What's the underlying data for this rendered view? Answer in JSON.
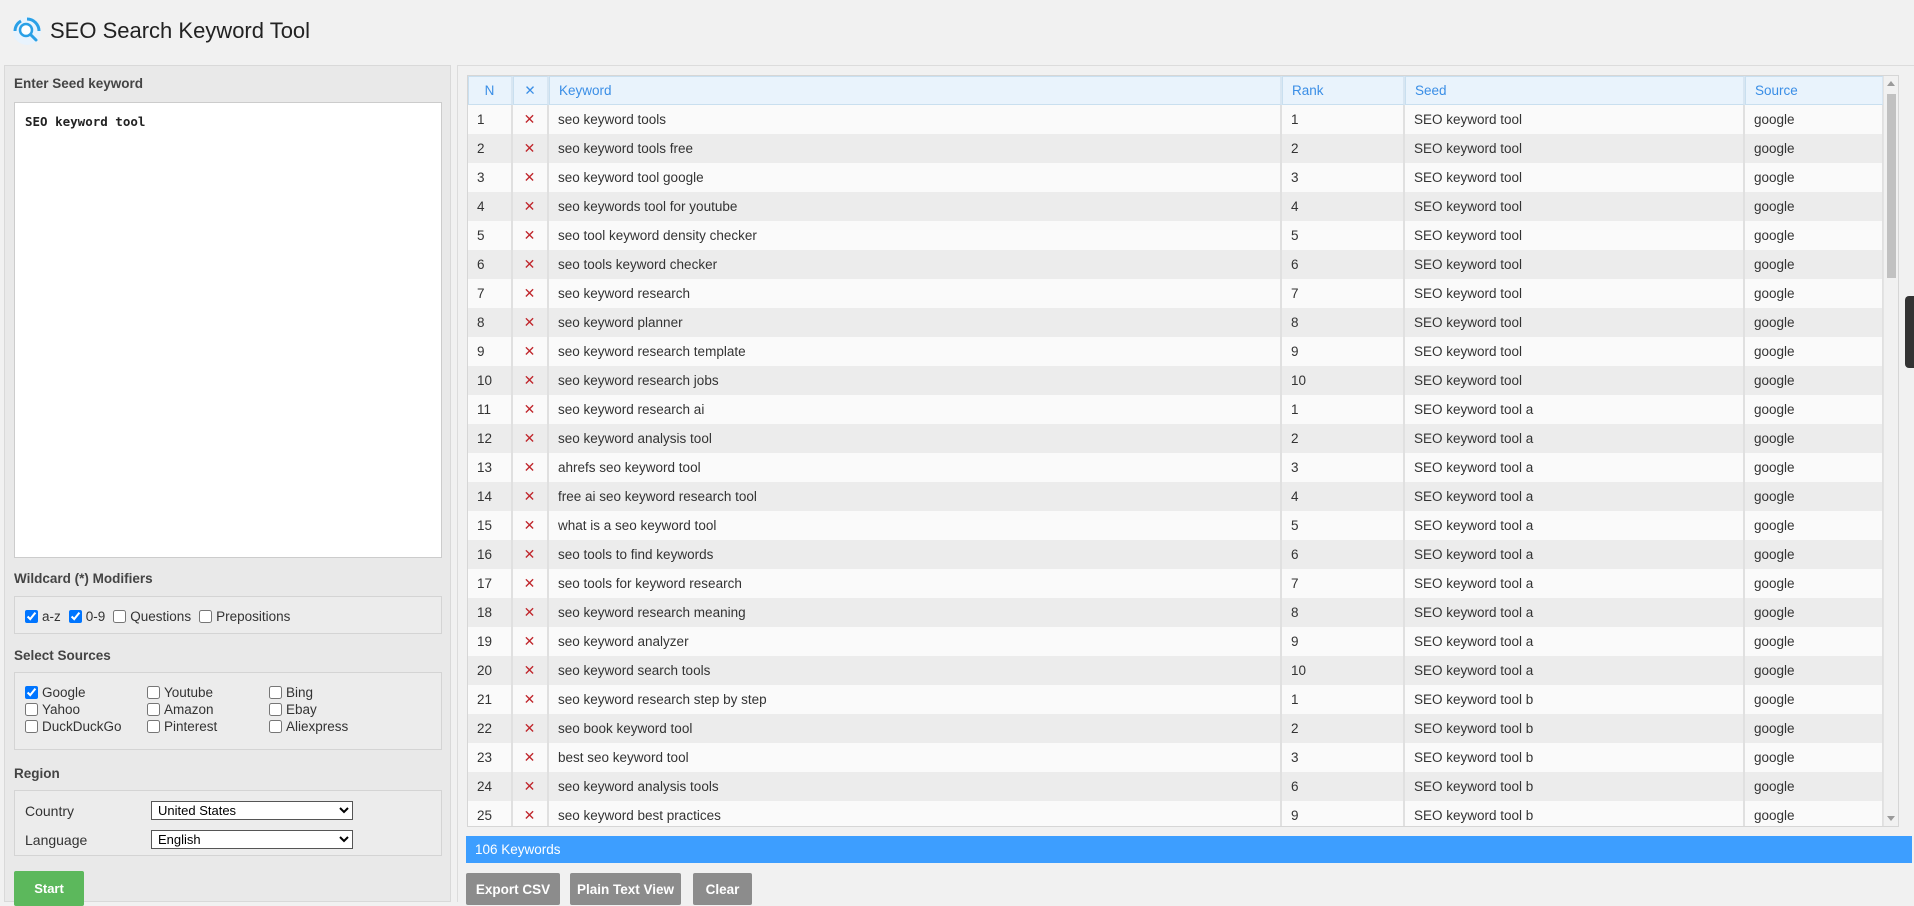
{
  "app": {
    "title": "SEO Search Keyword Tool",
    "logo_icon": "magnifier-logo-icon",
    "accent": "#3d9eff"
  },
  "seed": {
    "title": "Enter Seed keyword",
    "value": "SEO keyword tool"
  },
  "wildcard": {
    "title": "Wildcard (*) Modifiers",
    "options": [
      {
        "label": "a-z",
        "checked": true
      },
      {
        "label": "0-9",
        "checked": true
      },
      {
        "label": "Questions",
        "checked": false
      },
      {
        "label": "Prepositions",
        "checked": false
      }
    ]
  },
  "sources": {
    "title": "Select Sources",
    "options": [
      {
        "label": "Google",
        "checked": true
      },
      {
        "label": "Youtube",
        "checked": false
      },
      {
        "label": "Bing",
        "checked": false
      },
      {
        "label": "Yahoo",
        "checked": false
      },
      {
        "label": "Amazon",
        "checked": false
      },
      {
        "label": "Ebay",
        "checked": false
      },
      {
        "label": "DuckDuckGo",
        "checked": false
      },
      {
        "label": "Pinterest",
        "checked": false
      },
      {
        "label": "Aliexpress",
        "checked": false
      }
    ]
  },
  "region": {
    "title": "Region",
    "country_label": "Country",
    "country_value": "United States",
    "language_label": "Language",
    "language_value": "English"
  },
  "start_label": "Start",
  "table": {
    "headers": [
      "N",
      "✕",
      "Keyword",
      "Rank",
      "Seed",
      "Source"
    ],
    "remove_glyph": "✕",
    "rows": [
      [
        "1",
        "seo keyword tools",
        "1",
        "SEO keyword tool",
        "google"
      ],
      [
        "2",
        "seo keyword tools free",
        "2",
        "SEO keyword tool",
        "google"
      ],
      [
        "3",
        "seo keyword tool google",
        "3",
        "SEO keyword tool",
        "google"
      ],
      [
        "4",
        "seo keywords tool for youtube",
        "4",
        "SEO keyword tool",
        "google"
      ],
      [
        "5",
        "seo tool keyword density checker",
        "5",
        "SEO keyword tool",
        "google"
      ],
      [
        "6",
        "seo tools keyword checker",
        "6",
        "SEO keyword tool",
        "google"
      ],
      [
        "7",
        "seo keyword research",
        "7",
        "SEO keyword tool",
        "google"
      ],
      [
        "8",
        "seo keyword planner",
        "8",
        "SEO keyword tool",
        "google"
      ],
      [
        "9",
        "seo keyword research template",
        "9",
        "SEO keyword tool",
        "google"
      ],
      [
        "10",
        "seo keyword research jobs",
        "10",
        "SEO keyword tool",
        "google"
      ],
      [
        "11",
        "seo keyword research ai",
        "1",
        "SEO keyword tool a",
        "google"
      ],
      [
        "12",
        "seo keyword analysis tool",
        "2",
        "SEO keyword tool a",
        "google"
      ],
      [
        "13",
        "ahrefs seo keyword tool",
        "3",
        "SEO keyword tool a",
        "google"
      ],
      [
        "14",
        "free ai seo keyword research tool",
        "4",
        "SEO keyword tool a",
        "google"
      ],
      [
        "15",
        "what is a seo keyword tool",
        "5",
        "SEO keyword tool a",
        "google"
      ],
      [
        "16",
        "seo tools to find keywords",
        "6",
        "SEO keyword tool a",
        "google"
      ],
      [
        "17",
        "seo tools for keyword research",
        "7",
        "SEO keyword tool a",
        "google"
      ],
      [
        "18",
        "seo keyword research meaning",
        "8",
        "SEO keyword tool a",
        "google"
      ],
      [
        "19",
        "seo keyword analyzer",
        "9",
        "SEO keyword tool a",
        "google"
      ],
      [
        "20",
        "seo keyword search tools",
        "10",
        "SEO keyword tool a",
        "google"
      ],
      [
        "21",
        "seo keyword research step by step",
        "1",
        "SEO keyword tool b",
        "google"
      ],
      [
        "22",
        "seo book keyword tool",
        "2",
        "SEO keyword tool b",
        "google"
      ],
      [
        "23",
        "best seo keyword tool",
        "3",
        "SEO keyword tool b",
        "google"
      ],
      [
        "24",
        "seo keyword analysis tools",
        "6",
        "SEO keyword tool b",
        "google"
      ],
      [
        "25",
        "seo keyword best practices",
        "9",
        "SEO keyword tool b",
        "google"
      ]
    ]
  },
  "status": {
    "count_text": "106 Keywords"
  },
  "actions": {
    "export_label": "Export CSV",
    "plain_label": "Plain Text View",
    "clear_label": "Clear"
  }
}
